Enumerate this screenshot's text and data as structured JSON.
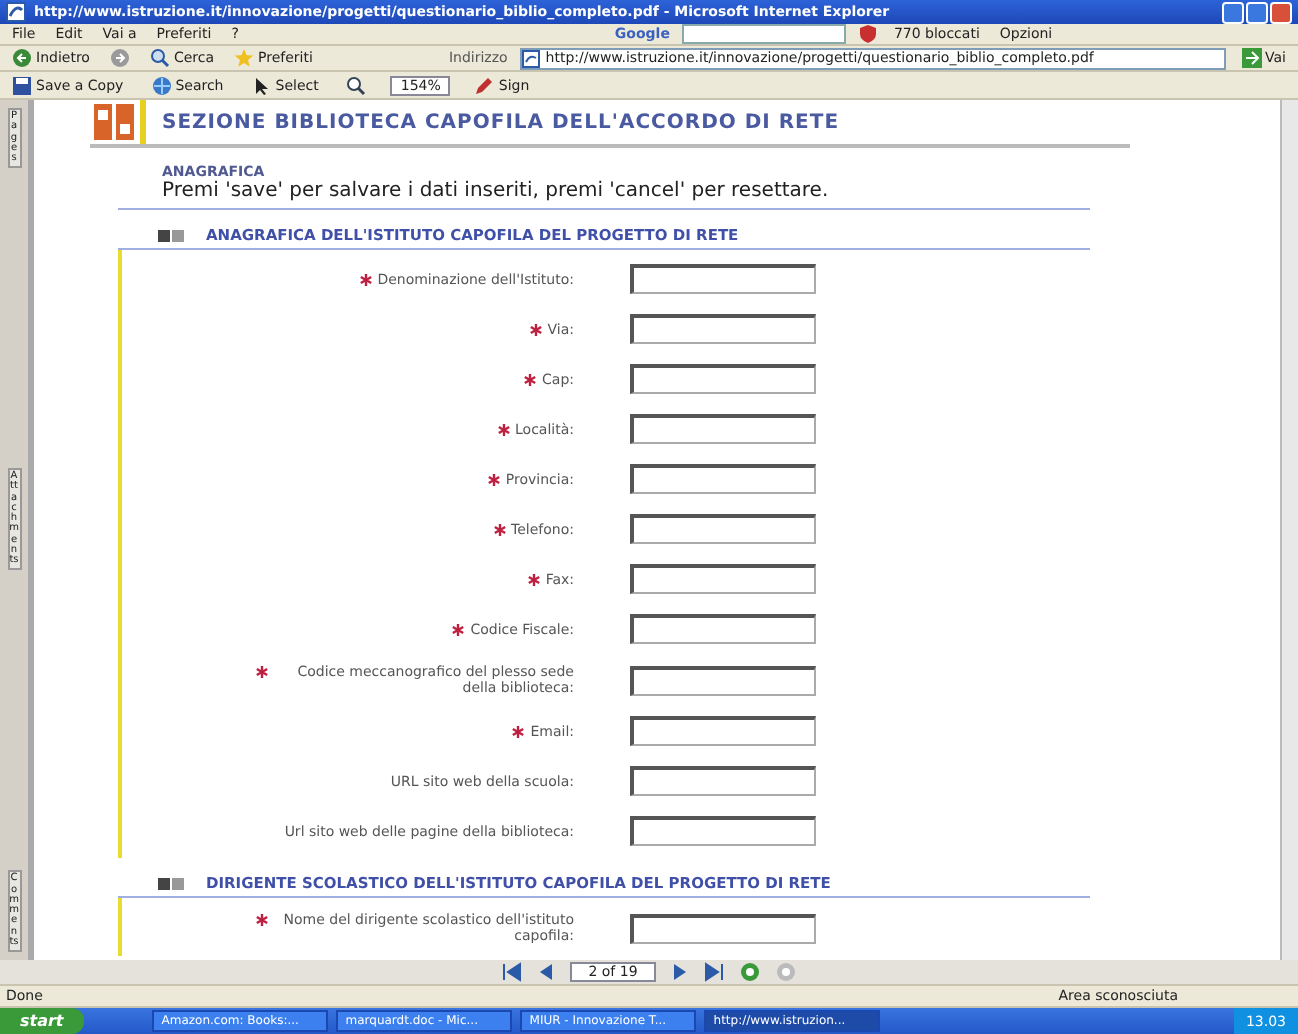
{
  "window": {
    "title": "http://www.istruzione.it/innovazione/progetti/questionario_biblio_completo.pdf - Microsoft Internet Explorer"
  },
  "menu": [
    "File",
    "Edit",
    "Vai a",
    "Preferiti",
    "?"
  ],
  "google_toolbar": {
    "brand": "Google",
    "blocked": "770 bloccati",
    "options": "Opzioni"
  },
  "nav_toolbar": [
    {
      "kind": "back",
      "label": "Indietro"
    },
    {
      "kind": "forward"
    },
    {
      "kind": "search",
      "label": "Cerca"
    },
    {
      "kind": "star",
      "label": "Preferiti"
    }
  ],
  "address": {
    "label": "Indirizzo",
    "value": "http://www.istruzione.it/innovazione/progetti/questionario_biblio_completo.pdf",
    "go": "Vai"
  },
  "pdf_toolbar": [
    {
      "kind": "save",
      "label": "Save a Copy"
    },
    {
      "kind": "globe",
      "label": "Search"
    },
    {
      "kind": "select",
      "label": "Select"
    },
    {
      "kind": "zoom"
    },
    {
      "kind": "zoomfield",
      "label": "154%"
    },
    {
      "kind": "pen",
      "label": "Sign"
    }
  ],
  "side_tabs": [
    "Pages",
    "Attachments",
    "Comments"
  ],
  "document": {
    "header": "SEZIONE BIBLIOTECA CAPOFILA DELL'ACCORDO DI RETE",
    "section_label": "ANAGRAFICA",
    "instruction": "Premi 'save' per salvare i dati inseriti, premi 'cancel' per resettare.",
    "sections": [
      {
        "title": "ANAGRAFICA DELL'ISTITUTO CAPOFILA DEL PROGETTO DI RETE",
        "fields": [
          {
            "label": "Denominazione dell'Istituto:",
            "required": true
          },
          {
            "label": "Via:",
            "required": true
          },
          {
            "label": "Cap:",
            "required": true
          },
          {
            "label": "Località:",
            "required": true
          },
          {
            "label": "Provincia:",
            "required": true
          },
          {
            "label": "Telefono:",
            "required": true
          },
          {
            "label": "Fax:",
            "required": true
          },
          {
            "label": "Codice Fiscale:",
            "required": true
          },
          {
            "label": "Codice meccanografico del plesso sede della biblioteca:",
            "required": true
          },
          {
            "label": "Email:",
            "required": true
          },
          {
            "label": "URL sito web della scuola:",
            "required": false
          },
          {
            "label": "Url sito web delle pagine della biblioteca:",
            "required": false
          }
        ]
      },
      {
        "title": "DIRIGENTE SCOLASTICO DELL'ISTITUTO CAPOFILA DEL PROGETTO DI RETE",
        "fields": [
          {
            "label": "Nome del dirigente scolastico dell'istituto capofila:",
            "required": true
          }
        ]
      }
    ]
  },
  "page_nav": {
    "page": "2 of 19"
  },
  "status_bar": {
    "left": "Done",
    "zone": "Area sconosciuta"
  },
  "taskbar": {
    "start": "start",
    "tasks": [
      {
        "label": "Amazon.com: Books:...",
        "selected": false
      },
      {
        "label": "marquardt.doc - Mic...",
        "selected": false
      },
      {
        "label": "MIUR - Innovazione T...",
        "selected": false
      },
      {
        "label": "http://www.istruzion...",
        "selected": true
      }
    ],
    "clock": "13.03"
  }
}
